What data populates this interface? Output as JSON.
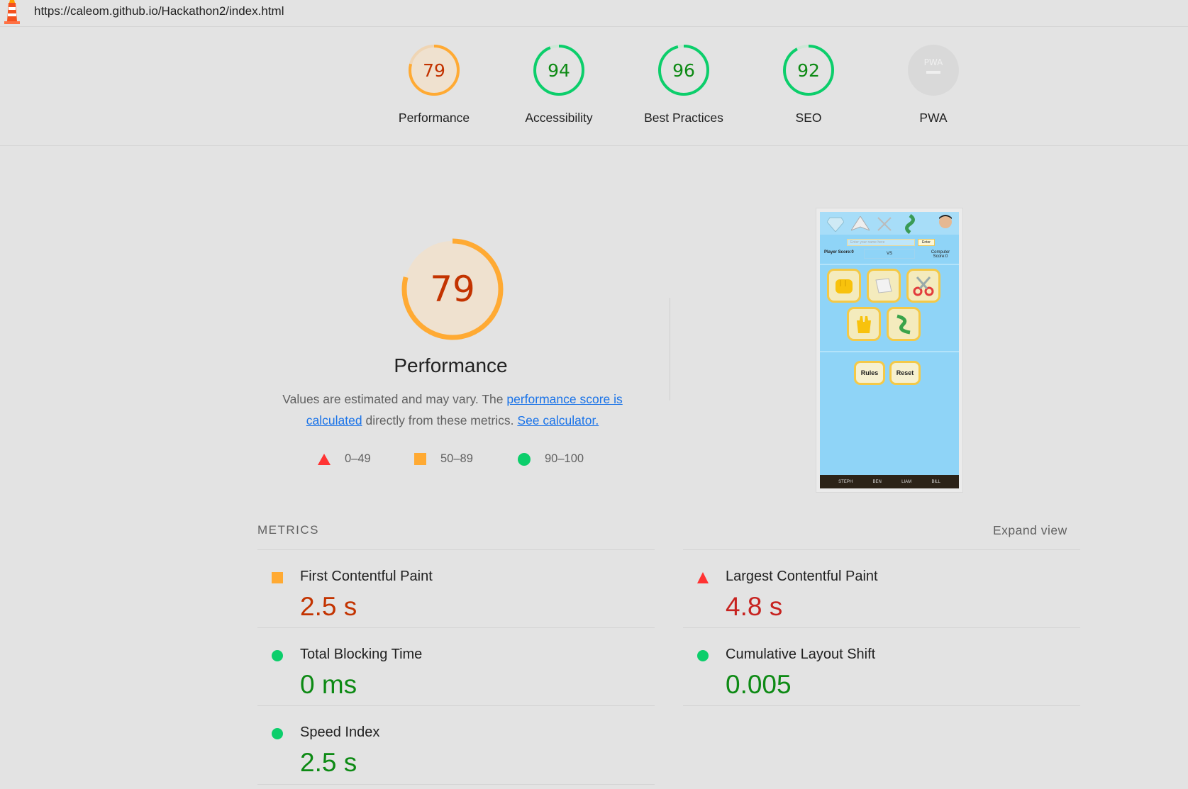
{
  "url": "https://caleom.github.io/Hackathon2/index.html",
  "colors": {
    "fail": "#ff3333",
    "average": "#ffaa33",
    "pass": "#0cce6b",
    "link": "#1a73e8"
  },
  "gauges": [
    {
      "score": "79",
      "label": "Performance",
      "rating": "average"
    },
    {
      "score": "94",
      "label": "Accessibility",
      "rating": "pass"
    },
    {
      "score": "96",
      "label": "Best Practices",
      "rating": "pass"
    },
    {
      "score": "92",
      "label": "SEO",
      "rating": "pass"
    },
    {
      "score": "",
      "label": "PWA",
      "rating": "pwa",
      "badge_text": "PWA"
    }
  ],
  "performance": {
    "score": "79",
    "title": "Performance",
    "desc_prefix": "Values are estimated and may vary. The ",
    "desc_link1": "performance score is calculated",
    "desc_middle": " directly from these metrics. ",
    "desc_link2": "See calculator."
  },
  "legend": [
    {
      "icon": "triangle-icon",
      "range": "0–49"
    },
    {
      "icon": "square-icon",
      "range": "50–89"
    },
    {
      "icon": "circle-icon",
      "range": "90–100"
    }
  ],
  "thumbnail": {
    "name_placeholder": "Enter your name here",
    "enter": "Enter",
    "player_score": "Player Score:0",
    "vs": "VS",
    "computer_score_line1": "Computer",
    "computer_score_line2": "Score:0",
    "rules": "Rules",
    "reset": "Reset",
    "footer": [
      "STEPH",
      "BEN",
      "LIAM",
      "BILL"
    ]
  },
  "metrics": {
    "header": "METRICS",
    "expand": "Expand view",
    "items": [
      {
        "name": "First Contentful Paint",
        "value": "2.5 s",
        "rating": "average"
      },
      {
        "name": "Largest Contentful Paint",
        "value": "4.8 s",
        "rating": "fail"
      },
      {
        "name": "Total Blocking Time",
        "value": "0 ms",
        "rating": "pass"
      },
      {
        "name": "Cumulative Layout Shift",
        "value": "0.005",
        "rating": "pass"
      },
      {
        "name": "Speed Index",
        "value": "2.5 s",
        "rating": "pass"
      }
    ]
  }
}
